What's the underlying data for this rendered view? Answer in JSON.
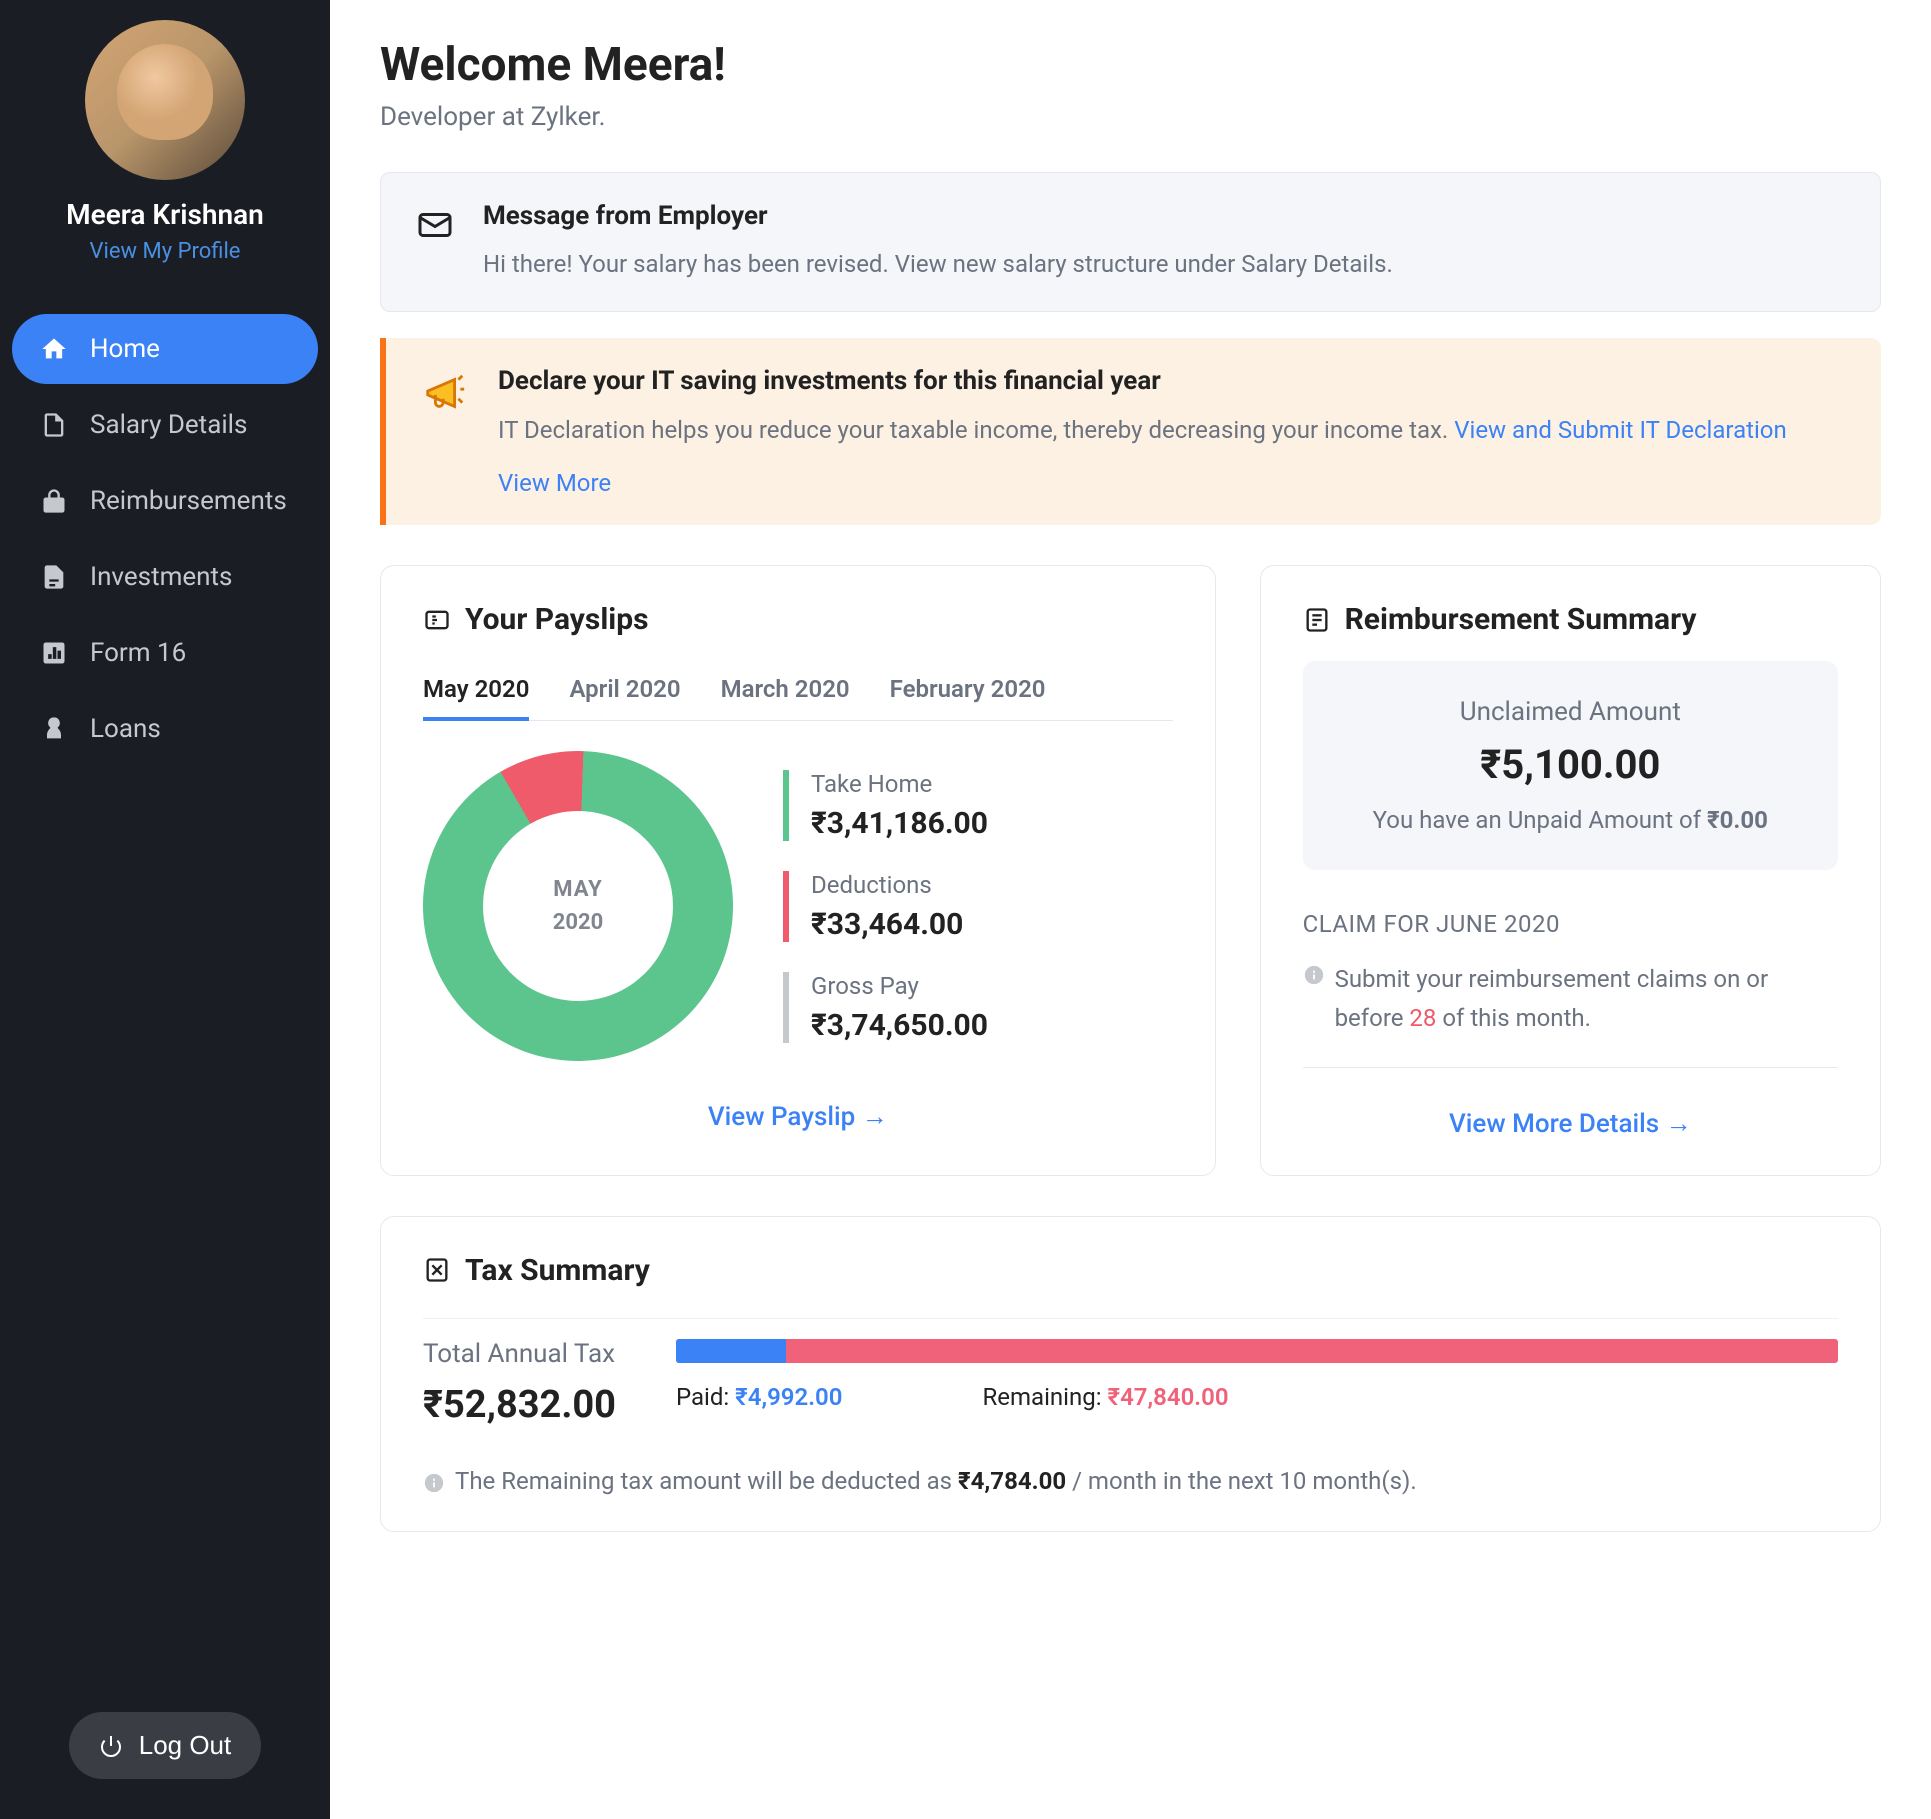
{
  "user": {
    "name": "Meera Krishnan",
    "profile_link": "View My Profile"
  },
  "sidebar": {
    "items": [
      {
        "label": "Home",
        "icon": "home-icon",
        "active": true
      },
      {
        "label": "Salary Details",
        "icon": "salary-icon",
        "active": false
      },
      {
        "label": "Reimbursements",
        "icon": "reimburse-icon",
        "active": false
      },
      {
        "label": "Investments",
        "icon": "investments-icon",
        "active": false
      },
      {
        "label": "Form 16",
        "icon": "form16-icon",
        "active": false
      },
      {
        "label": "Loans",
        "icon": "loans-icon",
        "active": false
      }
    ],
    "logout": "Log Out"
  },
  "welcome": {
    "title": "Welcome Meera!",
    "subtitle": "Developer at Zylker."
  },
  "message": {
    "title": "Message from Employer",
    "body": "Hi there! Your salary has been revised. View new salary structure under Salary Details."
  },
  "notice": {
    "title": "Declare your IT saving investments for this financial year",
    "body": "IT Declaration helps you reduce your taxable income, thereby decreasing your income tax. ",
    "link": "View and Submit IT Declaration",
    "view_more": "View More"
  },
  "payslips": {
    "title": "Your Payslips",
    "tabs": [
      "May 2020",
      "April 2020",
      "March 2020",
      "February 2020"
    ],
    "active_tab": 0,
    "donut": {
      "month": "MAY",
      "year": "2020"
    },
    "stats": {
      "take_home": {
        "label": "Take Home",
        "value": "₹3,41,186.00"
      },
      "deductions": {
        "label": "Deductions",
        "value": "₹33,464.00"
      },
      "gross": {
        "label": "Gross Pay",
        "value": "₹3,74,650.00"
      }
    },
    "footer_link": "View Payslip →"
  },
  "reimbursement": {
    "title": "Reimbursement Summary",
    "unclaimed_label": "Unclaimed Amount",
    "unclaimed_amount": "₹5,100.00",
    "unpaid_prefix": "You have an Unpaid Amount of ",
    "unpaid_amount": "₹0.00",
    "claim_label": "CLAIM FOR JUNE 2020",
    "claim_text_prefix": "Submit your reimbursement claims on or before ",
    "claim_date": "28",
    "claim_text_suffix": " of this month.",
    "footer_link": "View More Details →"
  },
  "tax": {
    "title": "Tax Summary",
    "total_label": "Total Annual Tax",
    "total_value": "₹52,832.00",
    "paid_label": "Paid: ",
    "paid_value": "₹4,992.00",
    "remaining_label": "Remaining: ",
    "remaining_value": "₹47,840.00",
    "paid_pct": 9.45,
    "note_prefix": "The Remaining tax amount will be deducted as ",
    "note_amount": "₹4,784.00",
    "note_suffix": " / month in the next 10 month(s)."
  },
  "chart_data": [
    {
      "type": "pie",
      "title": "May 2020 Payslip Breakdown",
      "series": [
        {
          "name": "Take Home",
          "value": 341186.0,
          "color": "#5bc58d"
        },
        {
          "name": "Deductions",
          "value": 33464.0,
          "color": "#ef5b6b"
        }
      ],
      "total_label": "Gross Pay",
      "total_value": 374650.0
    },
    {
      "type": "bar",
      "title": "Total Annual Tax",
      "orientation": "horizontal-stacked",
      "categories": [
        "Annual Tax"
      ],
      "series": [
        {
          "name": "Paid",
          "values": [
            4992.0
          ],
          "color": "#3b82f6"
        },
        {
          "name": "Remaining",
          "values": [
            47840.0
          ],
          "color": "#f0617a"
        }
      ],
      "total": 52832.0,
      "xlim": [
        0,
        52832.0
      ]
    }
  ]
}
